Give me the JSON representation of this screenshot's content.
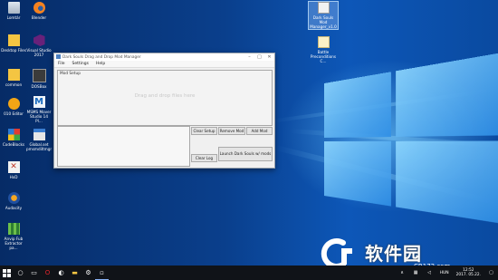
{
  "desktop_icons": [
    {
      "label": "Lomtár",
      "col": 0
    },
    {
      "label": "Blender",
      "col": 1
    },
    {
      "label": "Desktop Files",
      "col": 0
    },
    {
      "label": "Visual Studio 2017",
      "col": 1
    },
    {
      "label": "common",
      "col": 0
    },
    {
      "label": "DOSBox",
      "col": 1
    },
    {
      "label": "010 Editor",
      "col": 0
    },
    {
      "label": "MSMS Mover Studio 14 Pl...",
      "col": 1
    },
    {
      "label": "CodeBlocks",
      "col": 0
    },
    {
      "label": "Global.set pmsmdiltmgr",
      "col": 1
    },
    {
      "label": "HxD",
      "col": 0
    },
    {
      "label": "Audacity",
      "col": 0
    },
    {
      "label": "Anvip Fub Extractor pa...",
      "col": 0
    }
  ],
  "right_icons": [
    {
      "label": "Dark Souls Mod Manager_v1.0"
    },
    {
      "label": "Battle Preconditions C..."
    }
  ],
  "window": {
    "title": "Dark Souls Drag and Drop Mod Manager",
    "menu": [
      "File",
      "Settings",
      "Help"
    ],
    "mod_setup_label": "Mod Setup",
    "drop_hint": "Drag and drop files here",
    "buttons": {
      "clear_setup": "Clear Setup",
      "remove_mod": "Remove Mod",
      "add_mod": "Add Mod",
      "clear_log": "Clear Log",
      "launch": "Launch Dark Souls w/ mods"
    }
  },
  "taskbar": {
    "lang": "HUN",
    "time": "12:52",
    "date": "2017. 05.22."
  },
  "watermark": {
    "text": "软件园",
    "site": "CR173.com"
  },
  "colors": {
    "accent": "#0a4aa0",
    "taskbar": "#101318"
  }
}
